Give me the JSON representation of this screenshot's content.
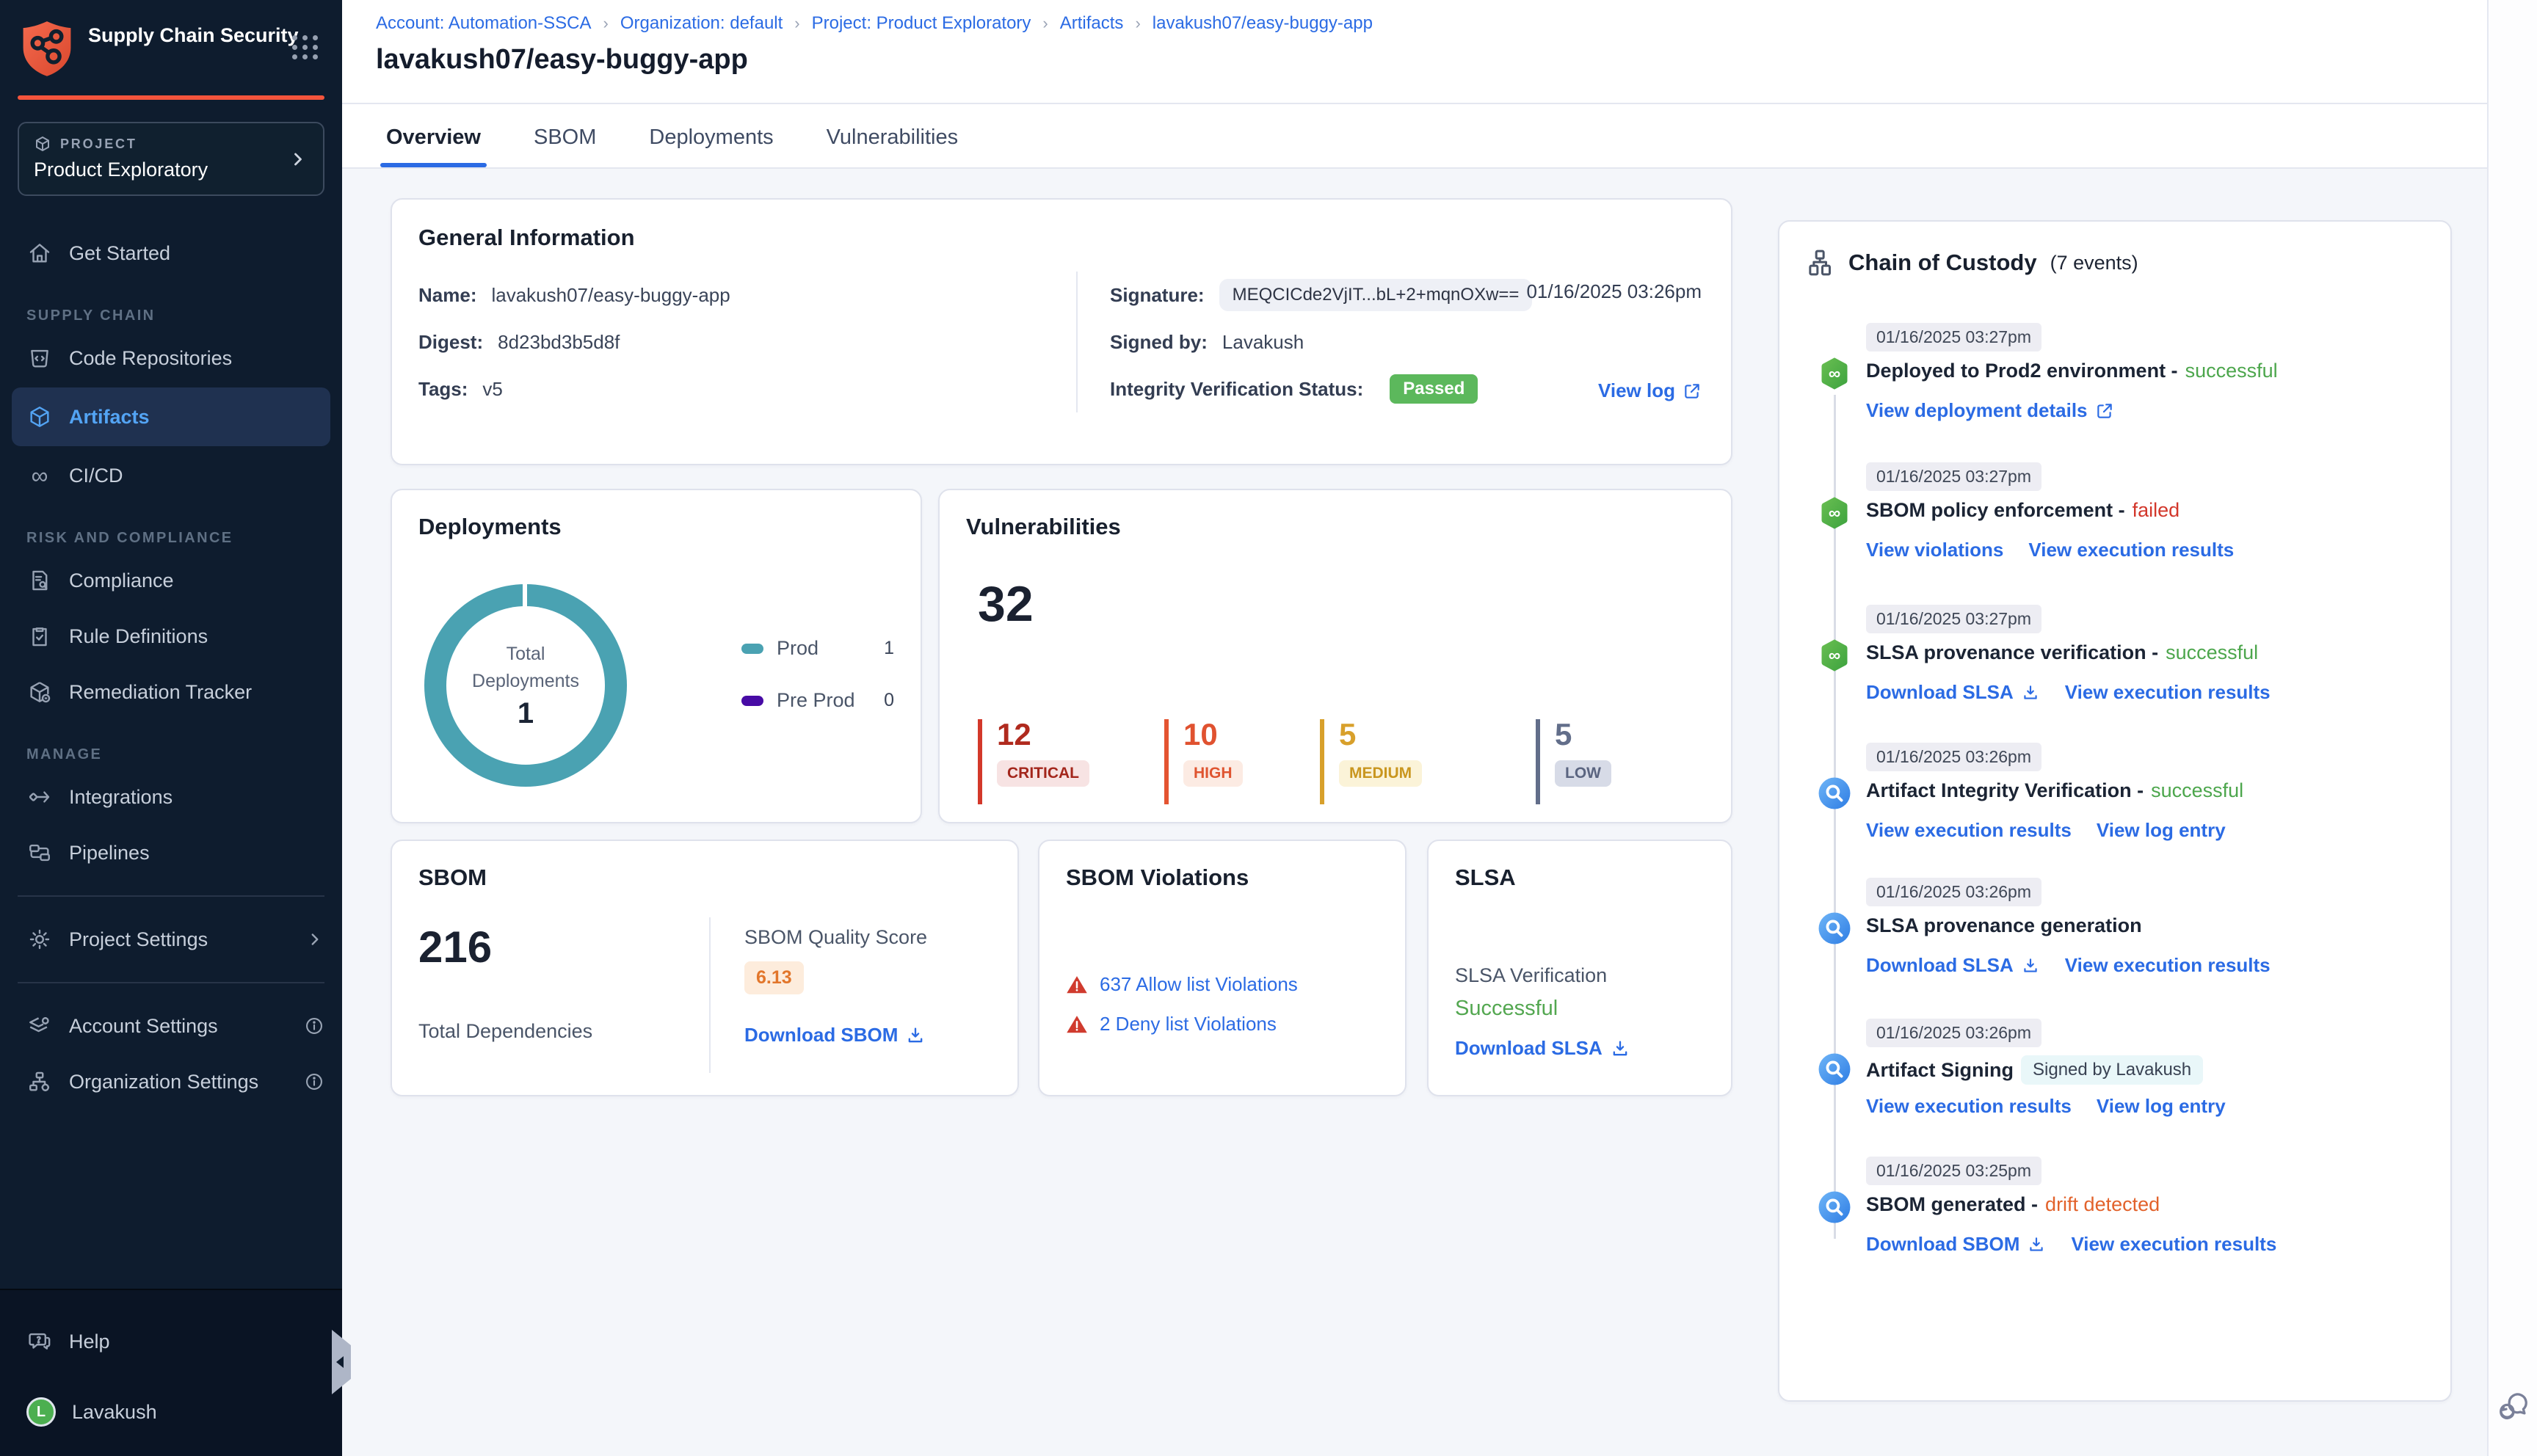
{
  "app": {
    "title": "Supply Chain Security"
  },
  "theme": {
    "accent_blue": "#2b6be4",
    "sidebar_bg": "#0e1c2e",
    "brand_orange": "#f4543c",
    "success_green": "#4ca64c",
    "error_red": "#d2372b",
    "drift_orange": "#e2622b",
    "donut_teal": "#4aa2b2",
    "preprod_purple": "#470ba5"
  },
  "sidebar": {
    "project_selector": {
      "label": "PROJECT",
      "name": "Product Exploratory"
    },
    "get_started": "Get Started",
    "section_supply_chain": "SUPPLY CHAIN",
    "code_repositories": "Code Repositories",
    "artifacts": "Artifacts",
    "cicd": "CI/CD",
    "section_risk": "RISK AND COMPLIANCE",
    "compliance": "Compliance",
    "rule_definitions": "Rule Definitions",
    "remediation_tracker": "Remediation Tracker",
    "section_manage": "MANAGE",
    "integrations": "Integrations",
    "pipelines": "Pipelines",
    "project_settings": "Project Settings",
    "account_settings": "Account Settings",
    "organization_settings": "Organization Settings",
    "help": "Help",
    "user": {
      "initial": "L",
      "name": "Lavakush"
    }
  },
  "breadcrumb": {
    "items": [
      "Account: Automation-SSCA",
      "Organization: default",
      "Project: Product Exploratory",
      "Artifacts",
      "lavakush07/easy-buggy-app"
    ]
  },
  "page": {
    "title": "lavakush07/easy-buggy-app"
  },
  "tabs": {
    "overview": "Overview",
    "sbom": "SBOM",
    "deployments": "Deployments",
    "vulnerabilities": "Vulnerabilities"
  },
  "general_info": {
    "title": "General Information",
    "name_label": "Name:",
    "name": "lavakush07/easy-buggy-app",
    "digest_label": "Digest:",
    "digest": "8d23bd3b5d8f",
    "tags_label": "Tags:",
    "tags": "v5",
    "signature_label": "Signature:",
    "signature": "MEQCICde2VjIT...bL+2+mqnOXw==",
    "signature_date": "01/16/2025 03:26pm",
    "signed_by_label": "Signed by:",
    "signed_by": "Lavakush",
    "integrity_label": "Integrity Verification Status:",
    "integrity_status": "Passed",
    "view_log": "View log"
  },
  "deployments": {
    "title": "Deployments",
    "center_label_line1": "Total",
    "center_label_line2": "Deployments",
    "total": "1",
    "legend": [
      {
        "name": "Prod",
        "value": "1",
        "color": "#4aa2b2"
      },
      {
        "name": "Pre Prod",
        "value": "0",
        "color": "#470ba5"
      }
    ]
  },
  "vulnerabilities": {
    "title": "Vulnerabilities",
    "total": "32",
    "severities": [
      {
        "label": "CRITICAL",
        "count": "12",
        "color": "#b02a1e"
      },
      {
        "label": "HIGH",
        "count": "10",
        "color": "#e05230"
      },
      {
        "label": "MEDIUM",
        "count": "5",
        "color": "#d8a02b"
      },
      {
        "label": "LOW",
        "count": "5",
        "color": "#626e8a"
      }
    ]
  },
  "sbom": {
    "title": "SBOM",
    "total": "216",
    "total_label": "Total Dependencies",
    "quality_label": "SBOM Quality Score",
    "quality_score": "6.13",
    "download_label": "Download SBOM"
  },
  "sbom_violations": {
    "title": "SBOM Violations",
    "allow_link": "637 Allow list Violations",
    "deny_link": "2 Deny list Violations"
  },
  "slsa": {
    "title": "SLSA",
    "verification_label": "SLSA Verification",
    "status": "Successful",
    "download_label": "Download SLSA"
  },
  "chain_of_custody": {
    "title": "Chain of Custody",
    "events_count": "(7 events)",
    "events": [
      {
        "timestamp": "01/16/2025 03:27pm",
        "title": "Deployed to Prod2 environment -",
        "status": "successful",
        "links": [
          {
            "label": "View deployment details"
          }
        ]
      },
      {
        "timestamp": "01/16/2025 03:27pm",
        "title": "SBOM policy enforcement -",
        "status": "failed",
        "links": [
          {
            "label": "View violations"
          },
          {
            "label": "View execution results"
          }
        ]
      },
      {
        "timestamp": "01/16/2025 03:27pm",
        "title": "SLSA provenance verification -",
        "status": "successful",
        "links": [
          {
            "label": "Download SLSA"
          },
          {
            "label": "View execution results"
          }
        ]
      },
      {
        "timestamp": "01/16/2025 03:26pm",
        "title": "Artifact Integrity Verification -",
        "status": "successful",
        "links": [
          {
            "label": "View execution results"
          },
          {
            "label": "View log entry"
          }
        ]
      },
      {
        "timestamp": "01/16/2025 03:26pm",
        "title": "SLSA provenance generation",
        "status": "",
        "links": [
          {
            "label": "Download SLSA"
          },
          {
            "label": "View execution results"
          }
        ]
      },
      {
        "timestamp": "01/16/2025 03:26pm",
        "title": "Artifact Signing",
        "status": "",
        "badge": "Signed by Lavakush",
        "links": [
          {
            "label": "View execution results"
          },
          {
            "label": "View log entry"
          }
        ]
      },
      {
        "timestamp": "01/16/2025 03:25pm",
        "title": "SBOM generated -",
        "status": "drift detected",
        "links": [
          {
            "label": "Download SBOM"
          },
          {
            "label": "View execution results"
          }
        ]
      }
    ]
  },
  "chart_data": {
    "type": "pie",
    "donut": true,
    "title": "Deployments",
    "labels": [
      "Prod",
      "Pre Prod"
    ],
    "values": [
      1,
      0
    ],
    "colors": [
      "#4aa2b2",
      "#470ba5"
    ],
    "center_label": "Total Deployments",
    "center_value": 1,
    "legend_position": "right"
  }
}
